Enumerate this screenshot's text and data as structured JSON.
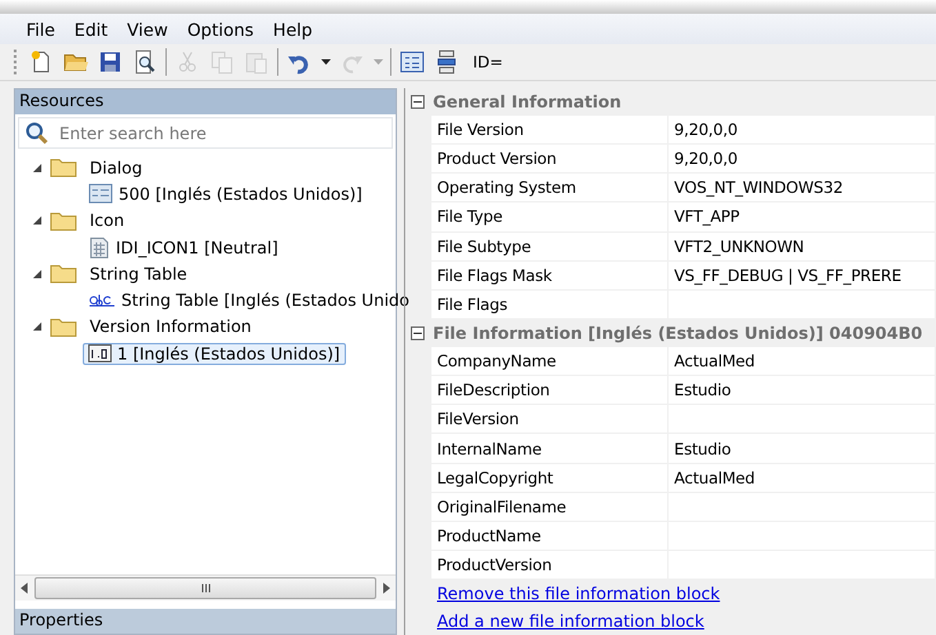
{
  "menu": [
    "File",
    "Edit",
    "View",
    "Options",
    "Help"
  ],
  "toolbar": [
    {
      "kind": "new",
      "disabled": false
    },
    {
      "kind": "open",
      "disabled": false
    },
    {
      "kind": "save",
      "disabled": false
    },
    {
      "kind": "preview",
      "disabled": false
    },
    {
      "kind": "sep"
    },
    {
      "kind": "cut",
      "disabled": true
    },
    {
      "kind": "copy",
      "disabled": true
    },
    {
      "kind": "paste",
      "disabled": true
    },
    {
      "kind": "sep"
    },
    {
      "kind": "undo",
      "disabled": false
    },
    {
      "kind": "caret",
      "disabled": false
    },
    {
      "kind": "redo",
      "disabled": true
    },
    {
      "kind": "caret",
      "disabled": true
    },
    {
      "kind": "sep"
    },
    {
      "kind": "form",
      "disabled": false
    },
    {
      "kind": "stack",
      "disabled": false
    }
  ],
  "id_label": "ID=",
  "resources": {
    "title": "Resources",
    "search": {
      "placeholder": "Enter search here"
    },
    "tree": [
      {
        "label": "Dialog",
        "expanded": true,
        "children": [
          {
            "label": "500 [Inglés (Estados Unidos)]",
            "kind": "dialog",
            "selected": false
          }
        ]
      },
      {
        "label": "Icon",
        "expanded": true,
        "children": [
          {
            "label": "IDI_ICON1 [Neutral]",
            "kind": "icon",
            "selected": false
          }
        ]
      },
      {
        "label": "String Table",
        "expanded": true,
        "children": [
          {
            "label": "String Table [Inglés (Estados Unido",
            "kind": "string",
            "selected": false
          }
        ]
      },
      {
        "label": "Version Information",
        "expanded": true,
        "children": [
          {
            "label": "1 [Inglés (Estados Unidos)]",
            "kind": "version",
            "selected": true
          }
        ]
      }
    ]
  },
  "properties_title": "Properties",
  "sections": [
    {
      "title": "General Information",
      "expanded": true,
      "rows": [
        {
          "name": "File Version",
          "value": "9,20,0,0"
        },
        {
          "name": "Product Version",
          "value": "9,20,0,0"
        },
        {
          "name": "Operating System",
          "value": "VOS_NT_WINDOWS32"
        },
        {
          "name": "File Type",
          "value": "VFT_APP"
        },
        {
          "name": "File Subtype",
          "value": "VFT2_UNKNOWN"
        },
        {
          "name": "File Flags Mask",
          "value": "VS_FF_DEBUG | VS_FF_PRERE"
        },
        {
          "name": "File Flags",
          "value": ""
        }
      ]
    },
    {
      "title": "File Information [Inglés (Estados Unidos)] 040904B0",
      "expanded": true,
      "rows": [
        {
          "name": "CompanyName",
          "value": "ActualMed"
        },
        {
          "name": "FileDescription",
          "value": "Estudio"
        },
        {
          "name": "FileVersion",
          "value": ""
        },
        {
          "name": "InternalName",
          "value": "Estudio"
        },
        {
          "name": "LegalCopyright",
          "value": "ActualMed"
        },
        {
          "name": "OriginalFilename",
          "value": ""
        },
        {
          "name": "ProductName",
          "value": ""
        },
        {
          "name": "ProductVersion",
          "value": ""
        }
      ],
      "links": [
        "Remove this file information block",
        "Add a new file information block"
      ]
    }
  ]
}
